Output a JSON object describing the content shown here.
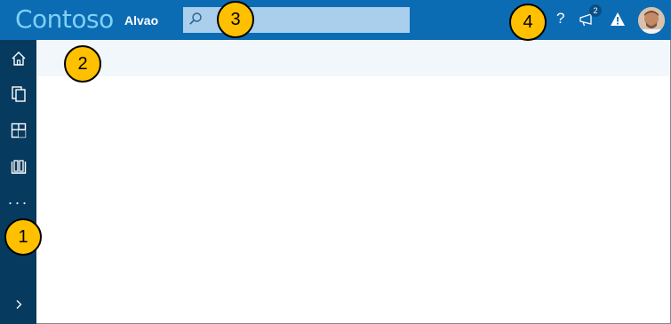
{
  "header": {
    "brand": "Contoso",
    "app_name": "Alvao",
    "search_placeholder": "",
    "help_label": "?",
    "notification_count": "2"
  },
  "sidebar": {
    "items": [
      {
        "icon": "home-icon"
      },
      {
        "icon": "documents-icon"
      },
      {
        "icon": "dashboard-icon"
      },
      {
        "icon": "book-icon"
      },
      {
        "icon": "more-icon",
        "label": "···"
      }
    ],
    "expand_icon": "chevron-right-icon"
  },
  "callouts": [
    "1",
    "2",
    "3",
    "4"
  ],
  "colors": {
    "topbar": "#0b6cb4",
    "brand_text": "#7fd0f5",
    "sidebar": "#063a5e",
    "subbar": "#f2f7fb",
    "search": "#a9cfec",
    "callout": "#ffc000"
  }
}
